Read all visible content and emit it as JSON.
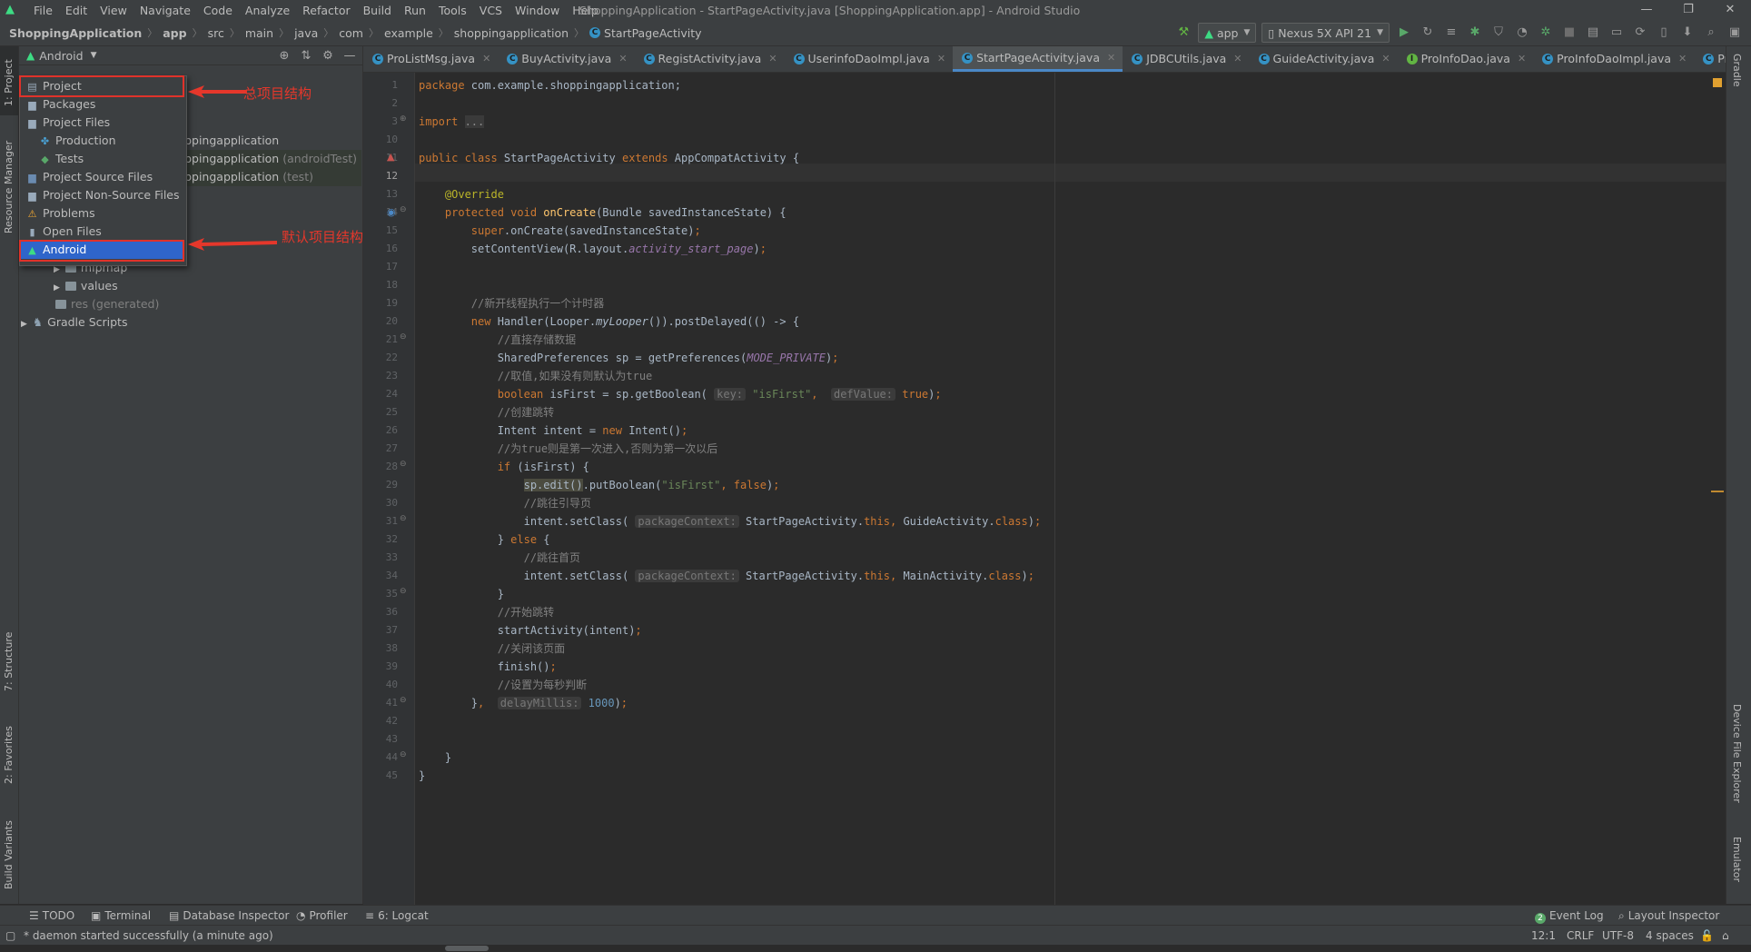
{
  "menu": {
    "items": [
      "File",
      "Edit",
      "View",
      "Navigate",
      "Code",
      "Analyze",
      "Refactor",
      "Build",
      "Run",
      "Tools",
      "VCS",
      "Window",
      "Help"
    ],
    "title": "ShoppingApplication - StartPageActivity.java [ShoppingApplication.app] - Android Studio"
  },
  "breadcrumbs": [
    "ShoppingApplication",
    "app",
    "src",
    "main",
    "java",
    "com",
    "example",
    "shoppingapplication",
    "StartPageActivity"
  ],
  "toolbar": {
    "run_config": "app",
    "device": "Nexus 5X API 21"
  },
  "project_panel": {
    "view_label": "Android",
    "tree": {
      "row1": "shoppingapplication",
      "row2": "shoppingapplication",
      "row2_suffix": "(androidTest)",
      "row3": "shoppingapplication",
      "row3_suffix": "(test)",
      "mipmap": "mipmap",
      "values": "values",
      "res": "res (generated)",
      "gradle": "Gradle Scripts"
    },
    "dropdown": [
      "Project",
      "Packages",
      "Project Files",
      "Production",
      "Tests",
      "Project Source Files",
      "Project Non-Source Files",
      "Problems",
      "Open Files",
      "Android"
    ],
    "dropdown_selected": "Android"
  },
  "annotations": {
    "a1": "总项目结构",
    "a2": "默认项目结构"
  },
  "tabs": [
    "ProListMsg.java",
    "BuyActivity.java",
    "RegistActivity.java",
    "UserinfoDaoImpl.java",
    "StartPageActivity.java",
    "JDBCUtils.java",
    "GuideActivity.java",
    "ProInfoDao.java",
    "ProInfoDaoImpl.java",
    "ProListActivit"
  ],
  "active_tab": "StartPageActivity.java",
  "line_numbers": [
    "1",
    "2",
    "3",
    "10",
    "11",
    "12",
    "13",
    "14",
    "15",
    "16",
    "17",
    "18",
    "19",
    "20",
    "21",
    "22",
    "23",
    "24",
    "25",
    "26",
    "27",
    "28",
    "29",
    "30",
    "31",
    "32",
    "33",
    "34",
    "35",
    "36",
    "37",
    "38",
    "39",
    "40",
    "41",
    "42",
    "43",
    "44",
    "45"
  ],
  "code": {
    "pkg": "com.example.shoppingapplication;",
    "import_fold": "...",
    "class_name": "StartPageActivity",
    "super_class": "AppCompatActivity",
    "c19": "//新开线程执行一个计时器",
    "c21": "//直接存储数据",
    "c23": "//取值,如果没有则默认为true",
    "c25": "//创建跳转",
    "c27": "//为true则是第一次进入,否则为第一次以后",
    "c30": "//跳往引导页",
    "c33": "//跳往首页",
    "c36": "//开始跳转",
    "c38": "//关闭该页面",
    "c40": "//设置为每秒判断",
    "str_isfirst": "\"isFirst\"",
    "num_delay": "1000",
    "hint_key": "key:",
    "hint_defvalue": "defValue:",
    "hint_context": "packageContext:",
    "hint_delay": "delayMillis:"
  },
  "left_stripe": [
    "1: Project",
    "Resource Manager",
    "7: Structure",
    "2: Favorites",
    "Build Variants"
  ],
  "right_stripe": [
    "Gradle",
    "Device File Explorer",
    "Emulator"
  ],
  "bottom_tools": [
    "TODO",
    "Terminal",
    "Database Inspector",
    "Profiler",
    "6: Logcat",
    "Event Log",
    "Layout Inspector"
  ],
  "status": {
    "message": "* daemon started successfully (a minute ago)",
    "position": "12:1",
    "line_sep": "CRLF",
    "encoding": "UTF-8",
    "indent": "4 spaces",
    "event_count": "2"
  }
}
